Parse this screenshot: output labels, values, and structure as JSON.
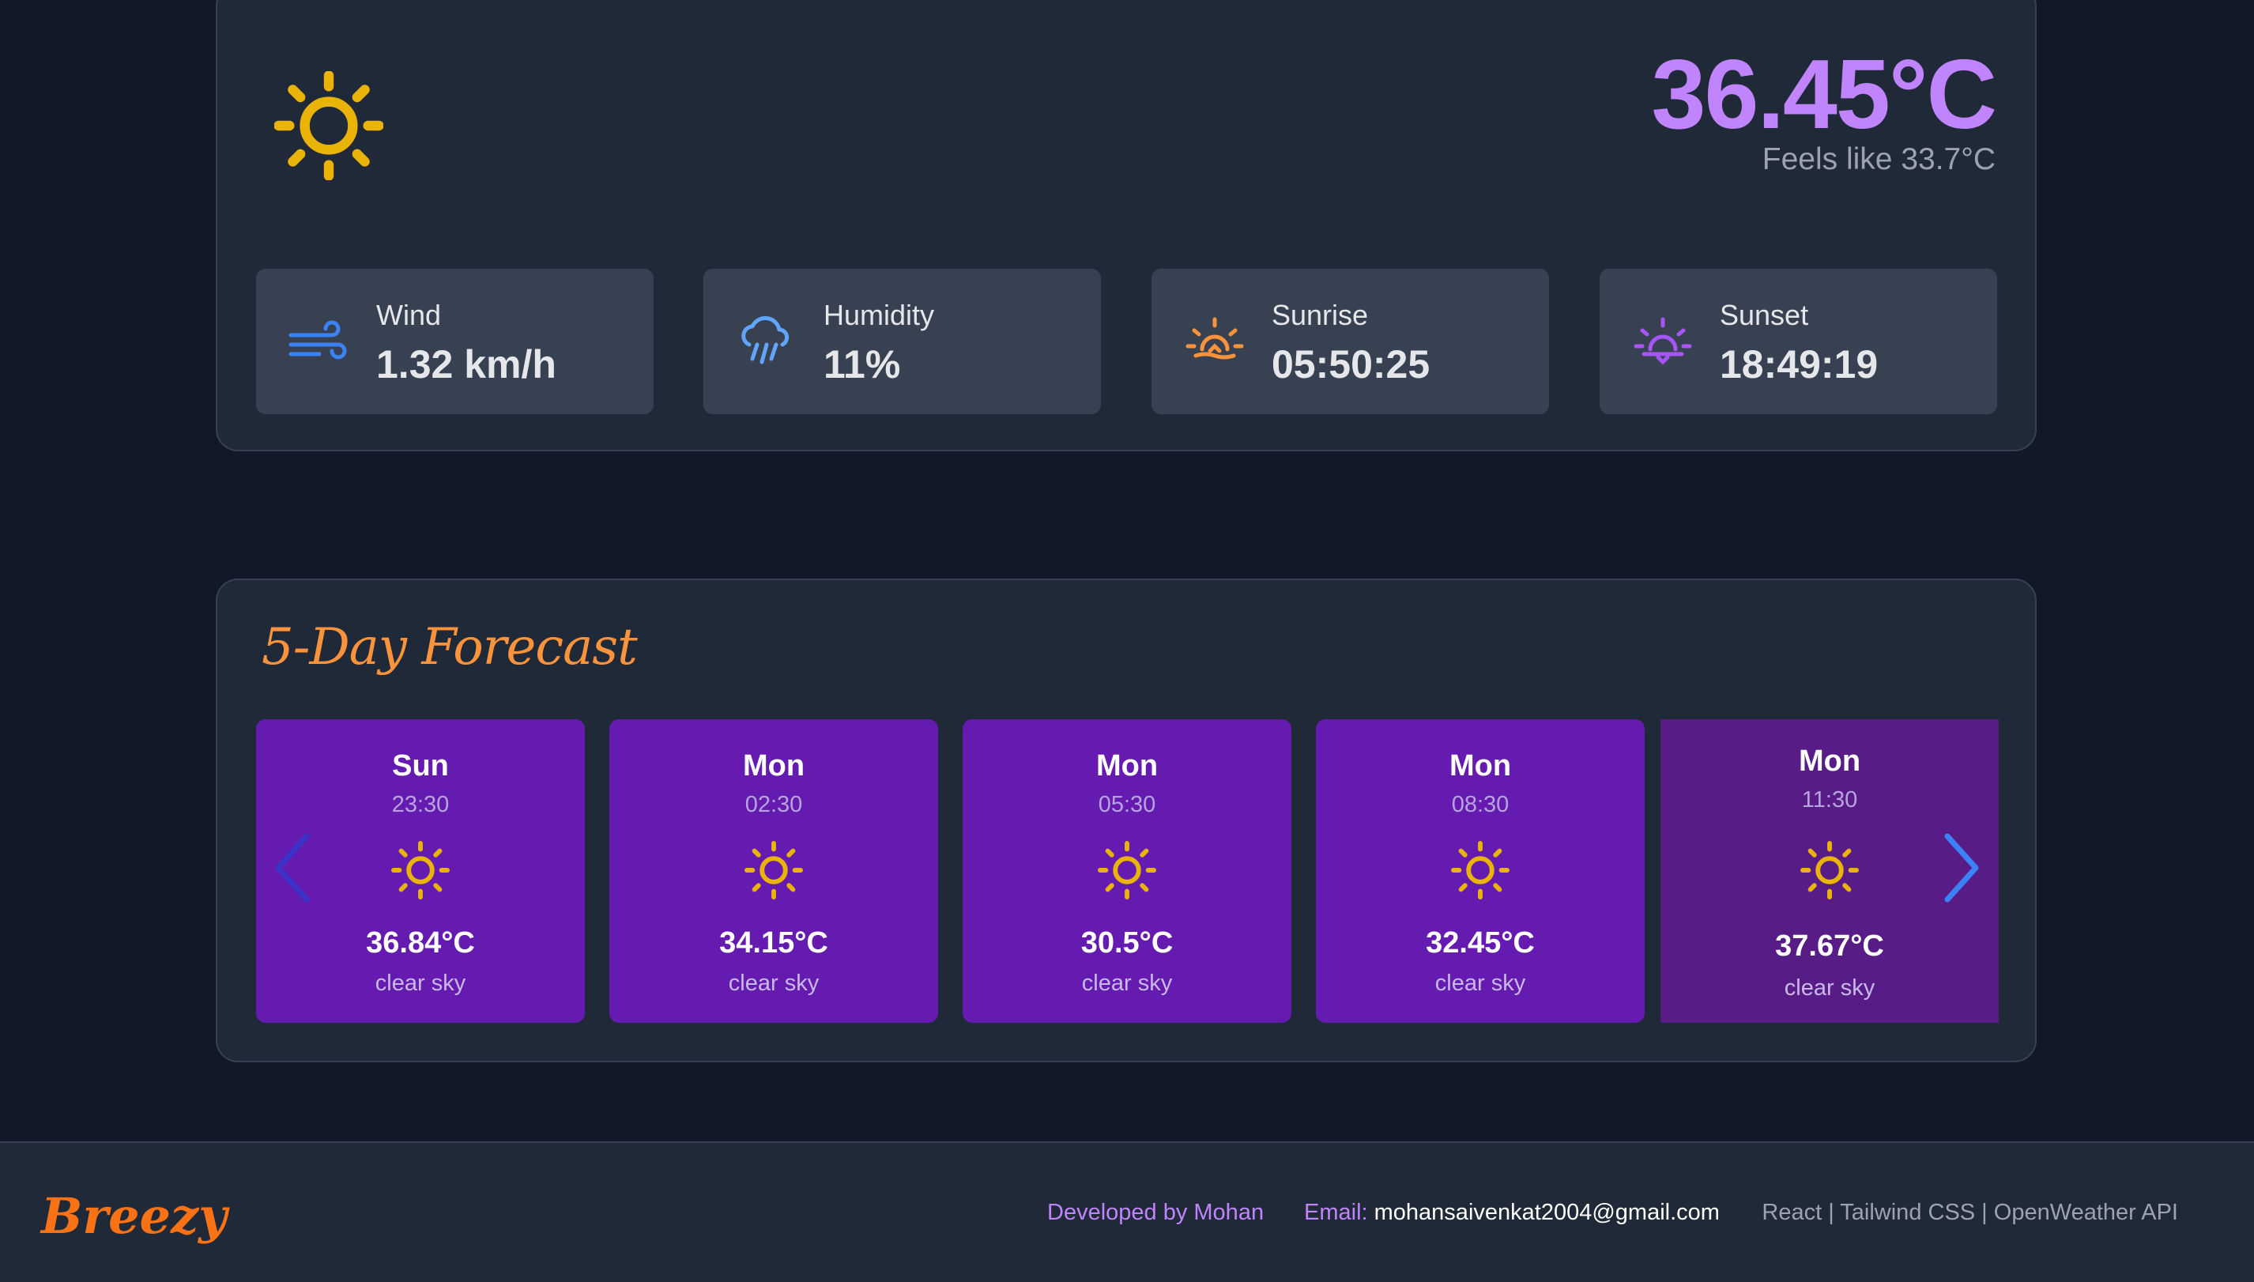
{
  "current": {
    "icon": "sun-icon",
    "temperature": "36.45°C",
    "feels_like": "Feels like 33.7°C",
    "stats": [
      {
        "label": "Wind",
        "value": "1.32 km/h",
        "icon": "wind-icon"
      },
      {
        "label": "Humidity",
        "value": "11%",
        "icon": "rain-cloud-icon"
      },
      {
        "label": "Sunrise",
        "value": "05:50:25",
        "icon": "sunrise-icon"
      },
      {
        "label": "Sunset",
        "value": "18:49:19",
        "icon": "sunset-icon"
      }
    ]
  },
  "forecast": {
    "title": "5-Day Forecast",
    "items": [
      {
        "day": "Sun",
        "time": "23:30",
        "temp": "36.84°C",
        "desc": "clear sky",
        "icon": "sun-icon"
      },
      {
        "day": "Mon",
        "time": "02:30",
        "temp": "34.15°C",
        "desc": "clear sky",
        "icon": "sun-icon"
      },
      {
        "day": "Mon",
        "time": "05:30",
        "temp": "30.5°C",
        "desc": "clear sky",
        "icon": "sun-icon"
      },
      {
        "day": "Mon",
        "time": "08:30",
        "temp": "32.45°C",
        "desc": "clear sky",
        "icon": "sun-icon"
      },
      {
        "day": "Mon",
        "time": "11:30",
        "temp": "37.67°C",
        "desc": "clear sky",
        "icon": "sun-icon"
      }
    ]
  },
  "footer": {
    "brand": "Breezy",
    "developed_by": "Developed by Mohan",
    "email_label": "Email:",
    "email": "mohansaivenkat2004@gmail.com",
    "tech": "React | Tailwind CSS | OpenWeather API"
  },
  "colors": {
    "accent_purple": "#c084fc",
    "accent_orange": "#fb923c",
    "sun_yellow": "#eab308",
    "card_purple": "#651bb0",
    "arrow_blue": "#3b82f6"
  }
}
